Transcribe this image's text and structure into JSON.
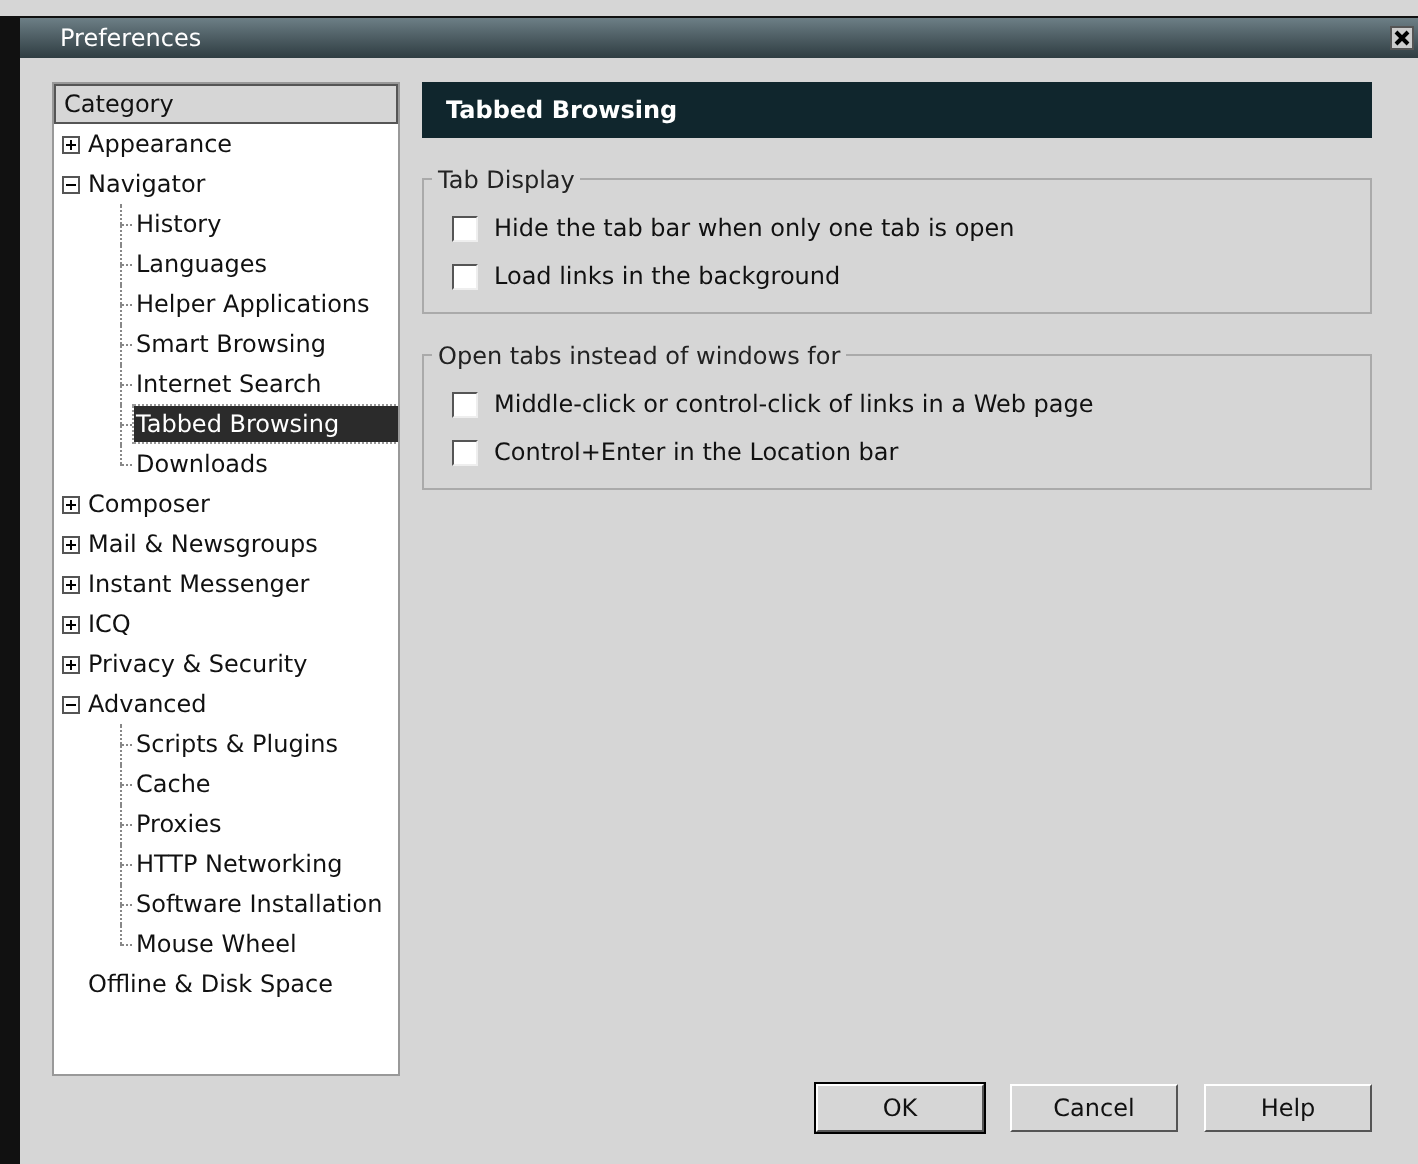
{
  "window": {
    "title": "Preferences"
  },
  "sidebar": {
    "header": "Category",
    "items": [
      {
        "label": "Appearance",
        "expanded": false,
        "selected": false
      },
      {
        "label": "Navigator",
        "expanded": true,
        "selected": false,
        "children": [
          {
            "label": "History",
            "selected": false
          },
          {
            "label": "Languages",
            "selected": false
          },
          {
            "label": "Helper Applications",
            "selected": false
          },
          {
            "label": "Smart Browsing",
            "selected": false
          },
          {
            "label": "Internet Search",
            "selected": false
          },
          {
            "label": "Tabbed Browsing",
            "selected": true
          },
          {
            "label": "Downloads",
            "selected": false
          }
        ]
      },
      {
        "label": "Composer",
        "expanded": false,
        "selected": false
      },
      {
        "label": "Mail & Newsgroups",
        "expanded": false,
        "selected": false
      },
      {
        "label": "Instant Messenger",
        "expanded": false,
        "selected": false
      },
      {
        "label": "ICQ",
        "expanded": false,
        "selected": false
      },
      {
        "label": "Privacy & Security",
        "expanded": false,
        "selected": false
      },
      {
        "label": "Advanced",
        "expanded": true,
        "selected": false,
        "children": [
          {
            "label": "Scripts & Plugins",
            "selected": false
          },
          {
            "label": "Cache",
            "selected": false
          },
          {
            "label": "Proxies",
            "selected": false
          },
          {
            "label": "HTTP Networking",
            "selected": false
          },
          {
            "label": "Software Installation",
            "selected": false
          },
          {
            "label": "Mouse Wheel",
            "selected": false
          }
        ]
      },
      {
        "label": "Offline & Disk Space",
        "selected": false
      }
    ]
  },
  "panel": {
    "title": "Tabbed Browsing",
    "groups": [
      {
        "legend": "Tab Display",
        "options": [
          {
            "label": "Hide the tab bar when only one tab is open",
            "checked": false
          },
          {
            "label": "Load links in the background",
            "checked": false
          }
        ]
      },
      {
        "legend": "Open tabs instead of windows for",
        "options": [
          {
            "label": "Middle-click or control-click of links in a Web page",
            "checked": false
          },
          {
            "label": "Control+Enter in the Location bar",
            "checked": false
          }
        ]
      }
    ]
  },
  "buttons": [
    {
      "label": "OK",
      "default": true
    },
    {
      "label": "Cancel",
      "default": false
    },
    {
      "label": "Help",
      "default": false
    }
  ]
}
